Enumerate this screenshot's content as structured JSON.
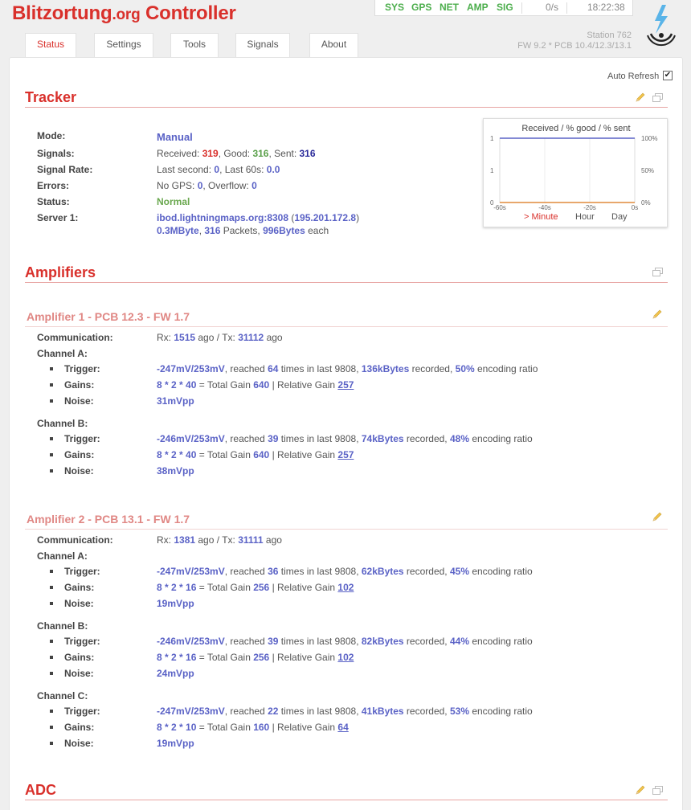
{
  "header": {
    "brand_main": "Blitzortung",
    "brand_org": ".org",
    "brand_rest": " Controller",
    "indicators": [
      "SYS",
      "GPS",
      "NET",
      "AMP",
      "SIG"
    ],
    "rate": "0/s",
    "time": "18:22:38",
    "station": "Station 762",
    "firmware": "FW 9.2  *  PCB 10.4/12.3/13.1"
  },
  "tabs": [
    "Status",
    "Settings",
    "Tools",
    "Signals",
    "About"
  ],
  "auto_refresh": {
    "label": "Auto Refresh",
    "checked": true
  },
  "tracker": {
    "title": "Tracker",
    "labels": {
      "mode": "Mode:",
      "signals": "Signals:",
      "signal_rate": "Signal Rate:",
      "errors": "Errors:",
      "status": "Status:",
      "server": "Server 1:"
    },
    "mode": "Manual",
    "signals": {
      "received_label": "Received: ",
      "received": "319",
      "good_label": ", Good: ",
      "good": "316",
      "sent_label": ", Sent: ",
      "sent": "316"
    },
    "rate": {
      "last_second_label": "Last second: ",
      "last_second": "0",
      "last_60s_label": ", Last 60s: ",
      "last_60s": "0.0"
    },
    "errors": {
      "nogps_label": "No GPS: ",
      "nogps": "0",
      "overflow_label": ", Overflow: ",
      "overflow": "0"
    },
    "status": "Normal",
    "server": {
      "host": "ibod.lightningmaps.org:8308",
      "ip_open": " (",
      "ip": "195.201.172.8",
      "ip_close": ")",
      "size": "0.3MByte",
      "sep1": ", ",
      "packets": "316",
      "packets_label": " Packets, ",
      "bytes": "996Bytes",
      "each": " each"
    },
    "chart": {
      "title": "Received / % good / % sent",
      "left_ticks": [
        "1",
        "1",
        "0"
      ],
      "right_ticks": [
        "100%",
        "50%",
        "0%"
      ],
      "x_ticks": [
        "-60s",
        "-40s",
        "-20s",
        "0s"
      ],
      "x_buttons": [
        "> Minute",
        "Hour",
        "Day"
      ]
    }
  },
  "chart_data": {
    "type": "line",
    "title": "Received / % good / % sent",
    "x": [
      "-60s",
      "-40s",
      "-20s",
      "0s"
    ],
    "series": [
      {
        "name": "Received",
        "values": [
          0,
          0,
          0,
          0
        ],
        "color": "#e08a3c"
      },
      {
        "name": "% good",
        "values": [
          100,
          100,
          100,
          100
        ],
        "color": "#5a62c6"
      }
    ],
    "ylim_left": [
      0,
      1
    ],
    "ylim_right": [
      0,
      100
    ]
  },
  "amplifiers": {
    "title": "Amplifiers",
    "labels": {
      "communication": "Communication:",
      "trigger": "Trigger:",
      "gains": "Gains:",
      "noise": "Noise:"
    },
    "text": {
      "rx": "Rx: ",
      "ago_tx": " ago / Tx: ",
      "ago": " ago",
      "reached": ", reached ",
      "times": " times in last ",
      "recorded": " recorded, ",
      "encoding": " encoding ratio",
      "total_gain": " = Total Gain ",
      "relative": " | Relative Gain "
    },
    "list": [
      {
        "title": "Amplifier 1 - PCB 12.3 - FW 1.7",
        "rx": "1515",
        "tx": "31112",
        "channels": [
          {
            "name": "Channel A:",
            "trigger": "-247mV/253mV",
            "times": "64",
            "last": "9808",
            "kbytes": "136kBytes",
            "ratio": "50%",
            "gains": "8 * 2 * 40",
            "total": "640",
            "relative": "257",
            "noise": "31mVpp"
          },
          {
            "name": "Channel B:",
            "trigger": "-246mV/253mV",
            "times": "39",
            "last": "9808",
            "kbytes": "74kBytes",
            "ratio": "48%",
            "gains": "8 * 2 * 40",
            "total": "640",
            "relative": "257",
            "noise": "38mVpp"
          }
        ]
      },
      {
        "title": "Amplifier 2 - PCB 13.1 - FW 1.7",
        "rx": "1381",
        "tx": "31111",
        "channels": [
          {
            "name": "Channel A:",
            "trigger": "-247mV/253mV",
            "times": "36",
            "last": "9808",
            "kbytes": "62kBytes",
            "ratio": "45%",
            "gains": "8 * 2 * 16",
            "total": "256",
            "relative": "102",
            "noise": "19mVpp"
          },
          {
            "name": "Channel B:",
            "trigger": "-246mV/253mV",
            "times": "39",
            "last": "9808",
            "kbytes": "82kBytes",
            "ratio": "44%",
            "gains": "8 * 2 * 16",
            "total": "256",
            "relative": "102",
            "noise": "24mVpp"
          },
          {
            "name": "Channel C:",
            "trigger": "-247mV/253mV",
            "times": "22",
            "last": "9808",
            "kbytes": "41kBytes",
            "ratio": "53%",
            "gains": "8 * 2 * 10",
            "total": "160",
            "relative": "64",
            "noise": "19mVpp"
          }
        ]
      }
    ]
  },
  "adc": {
    "title": "ADC"
  },
  "colors": {
    "accent": "#d9302b",
    "value": "#5a62c6",
    "ok": "#5aa04a",
    "indicator": "#4cae4c"
  }
}
